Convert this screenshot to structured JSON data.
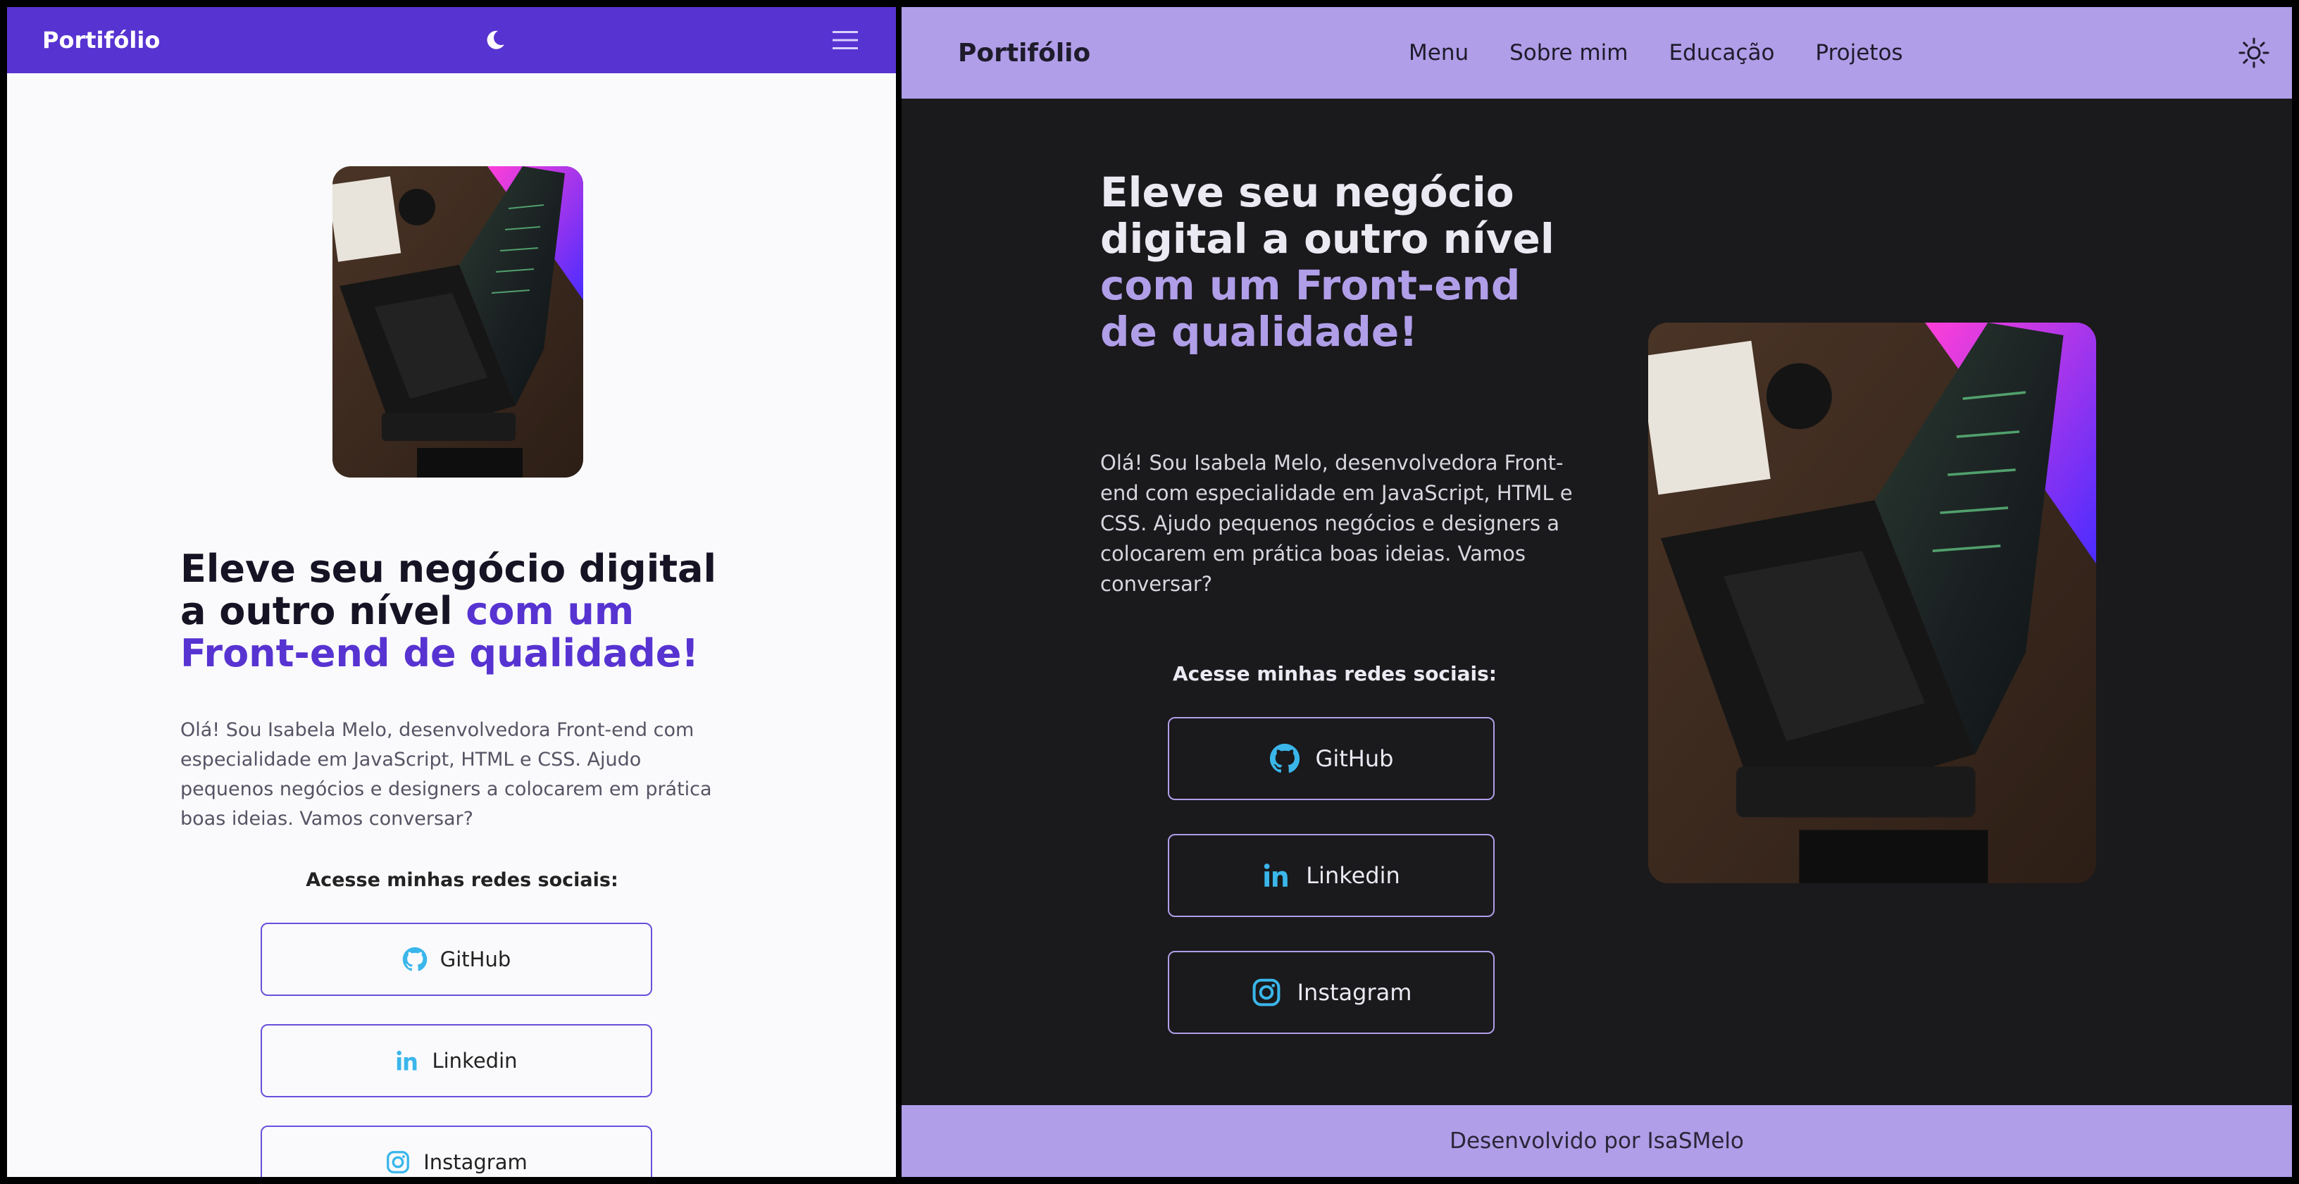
{
  "colors": {
    "light_nav_bg": "#5733d1",
    "light_accent": "#5733d1",
    "dark_bg": "#1a191c",
    "dark_nav_bg": "#b09ee8",
    "dark_accent": "#b09ee8",
    "icon_blue": "#3ab6ea"
  },
  "mobile": {
    "brand": "Portifólio",
    "theme_toggle_icon": "moon-icon",
    "menu_icon": "hamburger-menu-icon",
    "photo_alt": "laptop-desk-photo",
    "headline_part1": "Eleve seu negócio digital a outro nível ",
    "headline_accent": "com um Front-end de qualidade!",
    "intro": "Olá! Sou Isabela Melo, desenvolvedora Front-end com especialidade em JavaScript, HTML e CSS. Ajudo pequenos negócios e designers a colocarem em prática boas ideias. Vamos conversar?",
    "social_title": "Acesse minhas redes sociais:",
    "social": {
      "github": "GitHub",
      "linkedin": "Linkedin",
      "instagram": "Instagram"
    }
  },
  "desktop": {
    "brand": "Portifólio",
    "nav": {
      "menu": "Menu",
      "about": "Sobre mim",
      "education": "Educação",
      "projects": "Projetos"
    },
    "theme_toggle_icon": "sun-icon",
    "headline_part1": "Eleve seu negócio digital a outro nível ",
    "headline_accent": "com um Front-end de qualidade!",
    "intro": "Olá! Sou Isabela Melo, desenvolvedora Front-end com especialidade em JavaScript, HTML e CSS. Ajudo pequenos negócios e designers a colocarem em prática boas ideias. Vamos conversar?",
    "social_title": "Acesse minhas redes sociais:",
    "social": {
      "github": "GitHub",
      "linkedin": "Linkedin",
      "instagram": "Instagram"
    },
    "footer": "Desenvolvido por IsaSMelo"
  }
}
